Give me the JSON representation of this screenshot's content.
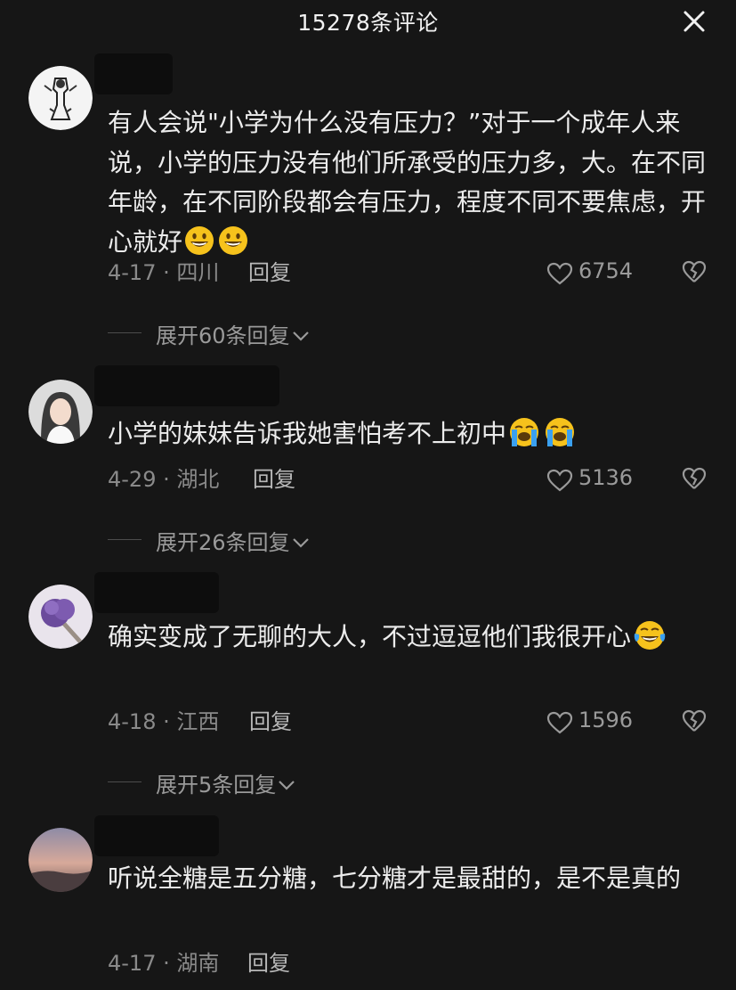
{
  "header": {
    "title": "15278条评论",
    "close_icon": "close-icon"
  },
  "comments": [
    {
      "text": "有人会说\"小学为什么没有压力？”对于一个成年人来说，小学的压力没有他们所承受的压力多，大。在不同年龄，在不同阶段都会有压力，程度不同不要焦虑，开心就好",
      "emojis": [
        "grinning-face",
        "grinning-face"
      ],
      "date_location": "4-17 · 四川",
      "reply_label": "回复",
      "likes": "6754",
      "expand_label": "展开60条回复"
    },
    {
      "text": "小学的妹妹告诉我她害怕考不上初中",
      "emojis": [
        "loudly-crying-face",
        "loudly-crying-face"
      ],
      "date_location": "4-29 · 湖北",
      "reply_label": "回复",
      "likes": "5136",
      "expand_label": "展开26条回复"
    },
    {
      "text": "确实变成了无聊的大人，不过逗逗他们我很开心",
      "emojis": [
        "tears-of-joy-face"
      ],
      "date_location": "4-18 · 江西",
      "reply_label": "回复",
      "likes": "1596",
      "expand_label": "展开5条回复"
    },
    {
      "text": "听说全糖是五分糖，七分糖才是最甜的，是不是真的",
      "emojis": [],
      "date_location": "4-17 · 湖南",
      "reply_label": "回复"
    }
  ],
  "colors": {
    "background": "#161616",
    "text": "#ececec",
    "meta": "#8a8a8a",
    "redaction": "#0d0d0d"
  }
}
